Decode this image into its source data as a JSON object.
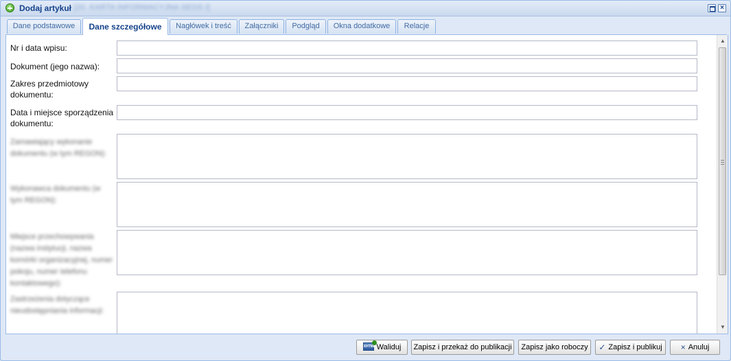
{
  "window": {
    "title": "Dodaj artykuł",
    "subtitle": "[20. KARTA INFORMACYJNA SEOS I]",
    "restore_symbol": "",
    "close_symbol": "×",
    "title_icon": "add-circle-icon"
  },
  "tabs": [
    {
      "label": "Dane podstawowe",
      "active": false
    },
    {
      "label": "Dane szczegółowe",
      "active": true
    },
    {
      "label": "Nagłówek i treść",
      "active": false
    },
    {
      "label": "Załączniki",
      "active": false
    },
    {
      "label": "Podgląd",
      "active": false
    },
    {
      "label": "Okna dodatkowe",
      "active": false
    },
    {
      "label": "Relacje",
      "active": false
    }
  ],
  "form": {
    "fields": [
      {
        "label": "Nr i data wpisu:",
        "value": ""
      },
      {
        "label": "Dokument (jego nazwa):",
        "value": ""
      },
      {
        "label": "Zakres przedmiotowy dokumentu:",
        "value": ""
      },
      {
        "label": "Data i miejsce sporządzenia dokumentu:",
        "value": ""
      },
      {
        "label": "Zamawiający wykonanie dokumentu (w tym REGON):",
        "value": ""
      },
      {
        "label": "Wykonawca dokumentu (w tym REGON):",
        "value": ""
      },
      {
        "label": "Miejsce przechowywania (nazwa instytucji, nazwa komórki organizacyjnej, numer pokoju, numer telefonu kontaktowego):",
        "value": ""
      },
      {
        "label": "Zastrzeżenia dotyczące nieudostępniania informacji:",
        "value": ""
      }
    ]
  },
  "scrollbar": {
    "up": "▲",
    "down": "▼"
  },
  "footer": {
    "validate": {
      "label": "Waliduj",
      "icon": "validate-icon",
      "icon_text": "XHTML"
    },
    "save_forward": {
      "label": "Zapisz i przekaż do publikacji"
    },
    "save_draft": {
      "label": "Zapisz jako roboczy"
    },
    "save_publish": {
      "label": "Zapisz i publikuj",
      "icon": "check-icon",
      "icon_glyph": "✓"
    },
    "cancel": {
      "label": "Anuluj",
      "icon": "close-icon",
      "icon_glyph": "×"
    }
  }
}
